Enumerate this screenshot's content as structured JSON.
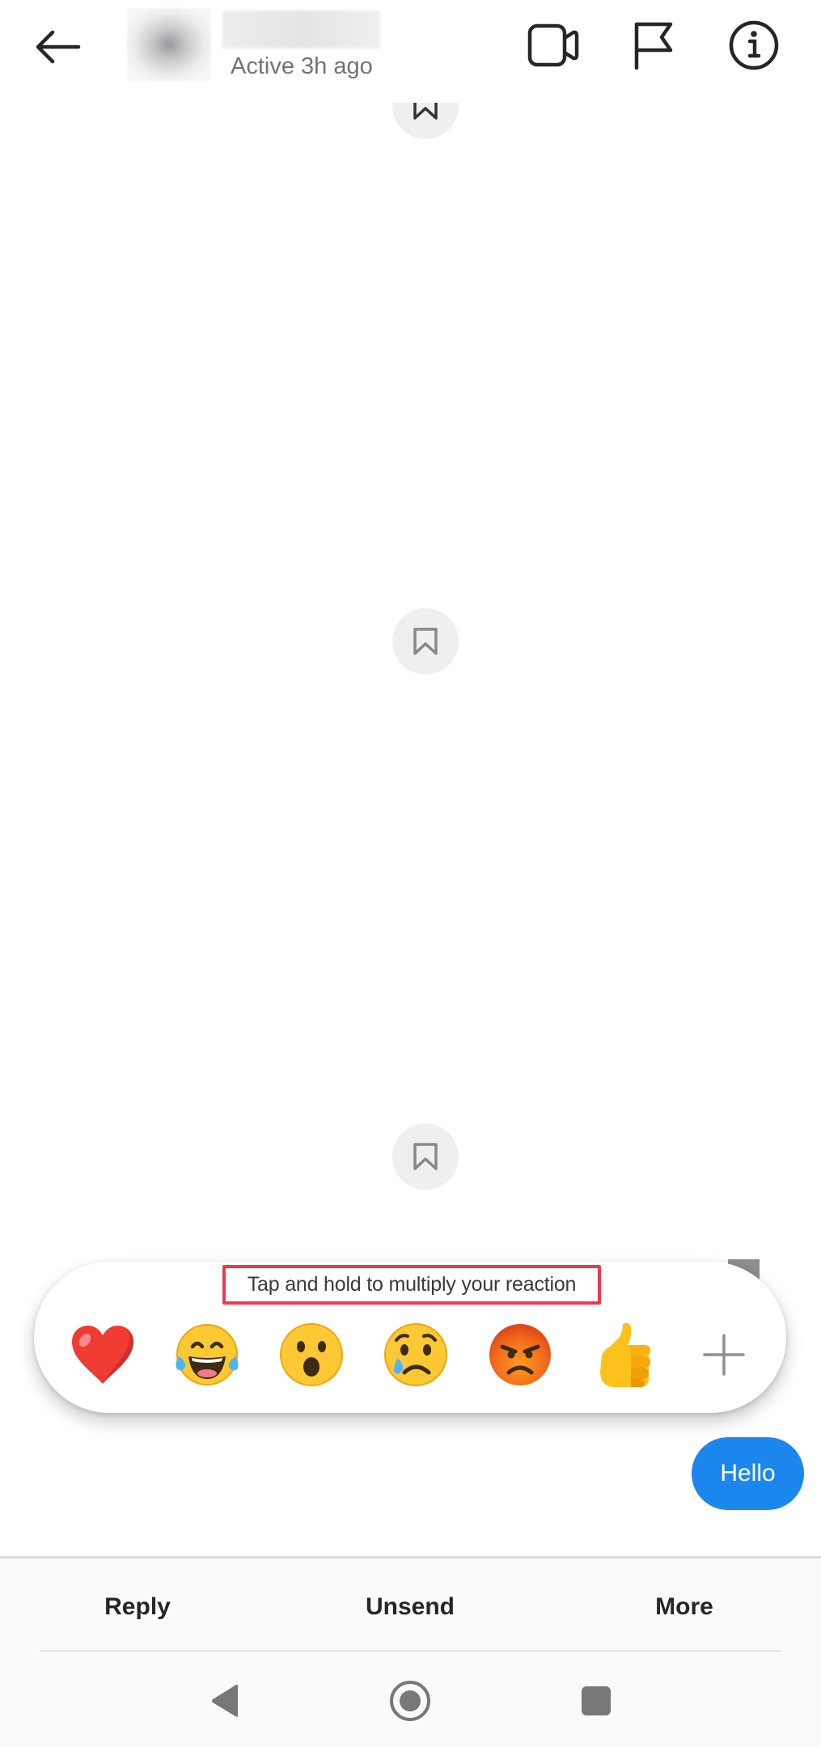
{
  "header": {
    "status": "Active 3h ago",
    "icons": {
      "back": "arrow-left-icon",
      "video": "video-camera-icon",
      "report": "flag-icon",
      "info": "info-icon"
    }
  },
  "chat": {
    "media_messages": [
      {
        "type": "image",
        "content": "redacted (black)"
      },
      {
        "type": "image",
        "content": "redacted (black)"
      },
      {
        "type": "image",
        "content": "redacted (black)"
      }
    ],
    "save_icon": "bookmark-icon",
    "text_messages": [
      {
        "text": "Hello",
        "sender": "me",
        "color": "#1b87ec"
      }
    ]
  },
  "reaction_picker": {
    "hint": "Tap and hold to multiply your reaction",
    "hint_highlight_color": "#f0384c",
    "reactions": [
      {
        "name": "heart",
        "emoji": "❤️"
      },
      {
        "name": "laughing-tears",
        "emoji": "😂"
      },
      {
        "name": "surprised",
        "emoji": "😮"
      },
      {
        "name": "crying",
        "emoji": "😢"
      },
      {
        "name": "angry",
        "emoji": "😡"
      },
      {
        "name": "thumbs-up",
        "emoji": "👍"
      }
    ],
    "more_label": "+"
  },
  "actions": {
    "reply": "Reply",
    "unsend": "Unsend",
    "more": "More"
  },
  "system_nav": {
    "back": "nav-back-icon",
    "home": "nav-home-icon",
    "recents": "nav-recents-icon"
  }
}
